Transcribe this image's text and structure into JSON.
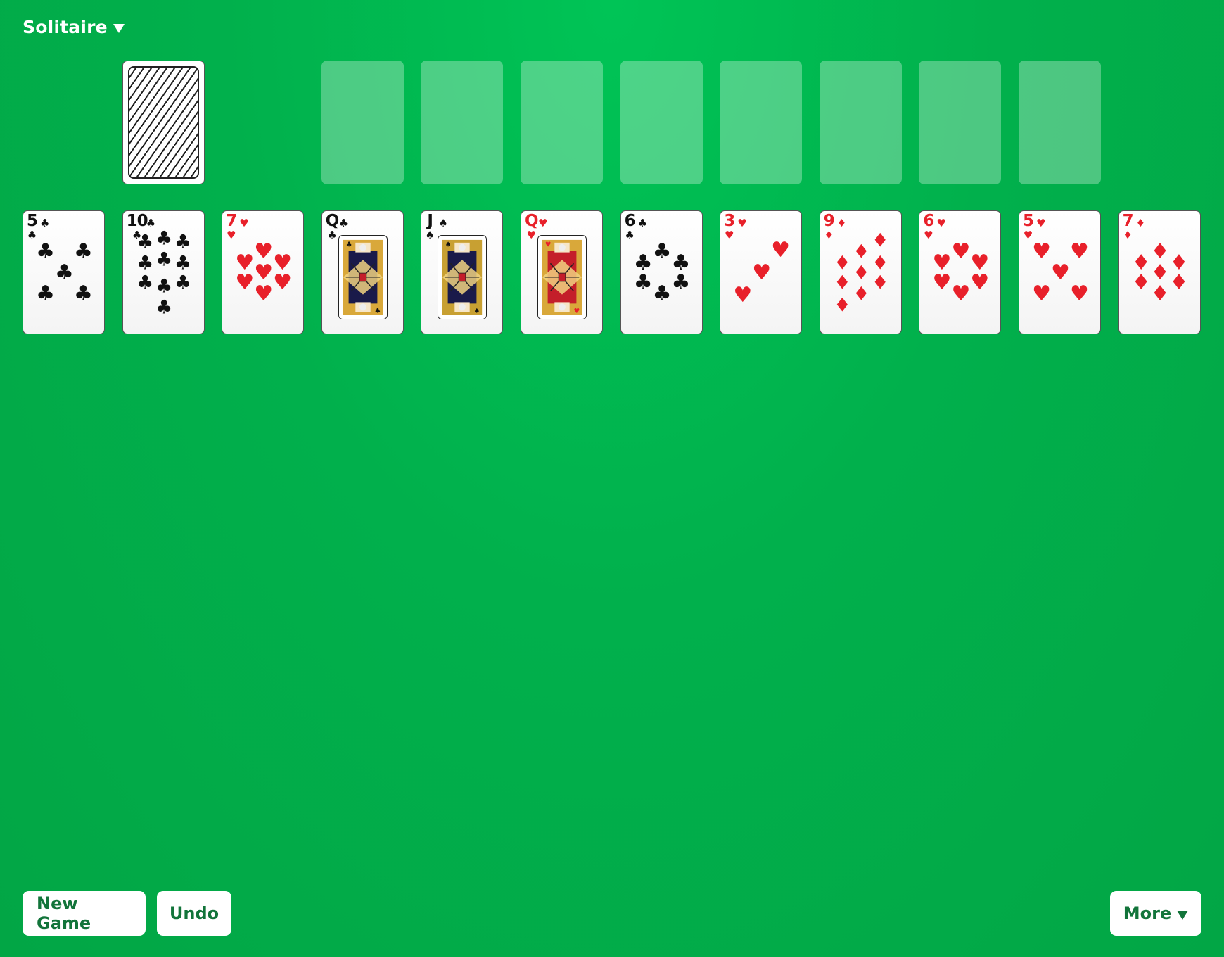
{
  "header": {
    "title": "Solitaire"
  },
  "buttons": {
    "new_game": "New Game",
    "undo": "Undo",
    "more": "More"
  },
  "colors": {
    "felt": "#02ae4a",
    "button_text": "#12743a",
    "red_suit": "#e8202a",
    "black_suit": "#111111"
  },
  "foundations": {
    "empty_slots": 8
  },
  "stock": {
    "face_down": true
  },
  "tableau": [
    {
      "rank": "5",
      "suit": "clubs",
      "symbol": "♣",
      "color": "black"
    },
    {
      "rank": "10",
      "suit": "clubs",
      "symbol": "♣",
      "color": "black"
    },
    {
      "rank": "7",
      "suit": "hearts",
      "symbol": "♥",
      "color": "red"
    },
    {
      "rank": "Q",
      "suit": "clubs",
      "symbol": "♣",
      "color": "black"
    },
    {
      "rank": "J",
      "suit": "spades",
      "symbol": "♠",
      "color": "black"
    },
    {
      "rank": "Q",
      "suit": "hearts",
      "symbol": "♥",
      "color": "red"
    },
    {
      "rank": "6",
      "suit": "clubs",
      "symbol": "♣",
      "color": "black"
    },
    {
      "rank": "3",
      "suit": "hearts",
      "symbol": "♥",
      "color": "red"
    },
    {
      "rank": "9",
      "suit": "diamonds",
      "symbol": "♦",
      "color": "red"
    },
    {
      "rank": "6",
      "suit": "hearts",
      "symbol": "♥",
      "color": "red"
    },
    {
      "rank": "5",
      "suit": "hearts",
      "symbol": "♥",
      "color": "red"
    },
    {
      "rank": "7",
      "suit": "diamonds",
      "symbol": "♦",
      "color": "red"
    }
  ]
}
